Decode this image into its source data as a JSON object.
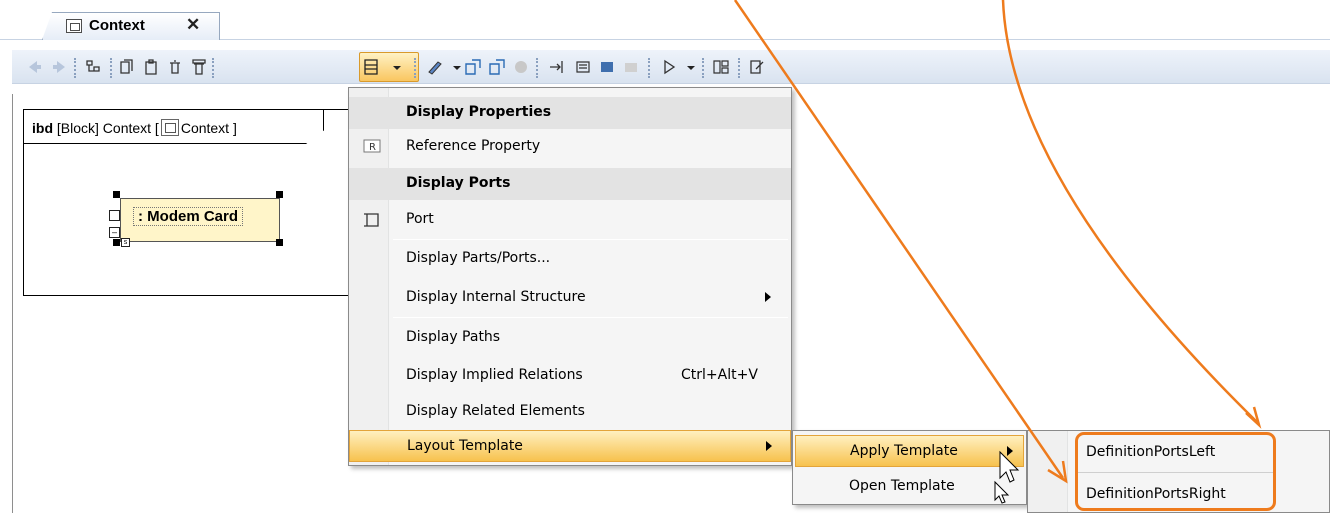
{
  "tab": {
    "title": "Context",
    "close": "✕"
  },
  "toolbar": {
    "icons": [
      "back-icon",
      "forward-icon",
      "containment-icon",
      "copy-icon",
      "paste-icon",
      "delete-icon",
      "delete-from-model-icon",
      "display-properties-icon",
      "pen-icon",
      "add-element-icon",
      "add-element-2-icon",
      "lock-icon",
      "expand-icon",
      "note-icon",
      "image-icon",
      "shape-icon",
      "play-icon",
      "layout-icon",
      "validate-icon"
    ]
  },
  "diagram": {
    "kind": "ibd",
    "frame_label": "[Block] Context [",
    "frame_name": "Context ]",
    "part_label": ": Modem Card"
  },
  "menu": {
    "items": [
      {
        "label": "Display Properties",
        "type": "header"
      },
      {
        "label": "Reference Property",
        "icon": "reference-property-icon"
      },
      {
        "label": "Display Ports",
        "type": "header"
      },
      {
        "label": "Port",
        "icon": "port-icon"
      },
      {
        "label": "Display Parts/Ports..."
      },
      {
        "label": "Display Internal Structure",
        "submenu": true
      },
      {
        "label": "Display Paths"
      },
      {
        "label": "Display Implied Relations",
        "shortcut": "Ctrl+Alt+V"
      },
      {
        "label": "Display Related Elements"
      },
      {
        "label": "Layout Template",
        "submenu": true,
        "highlighted": true
      }
    ]
  },
  "layout_submenu": {
    "items": [
      {
        "label": "Apply Template",
        "submenu": true,
        "highlighted": true
      },
      {
        "label": "Open Template"
      }
    ]
  },
  "template_submenu": {
    "items": [
      {
        "label": "DefinitionPortsLeft"
      },
      {
        "label": "DefinitionPortsRight"
      }
    ]
  },
  "colors": {
    "annotation": "#ee7b1d",
    "highlight": "#f7c24e",
    "part_fill": "#fff5c9"
  }
}
